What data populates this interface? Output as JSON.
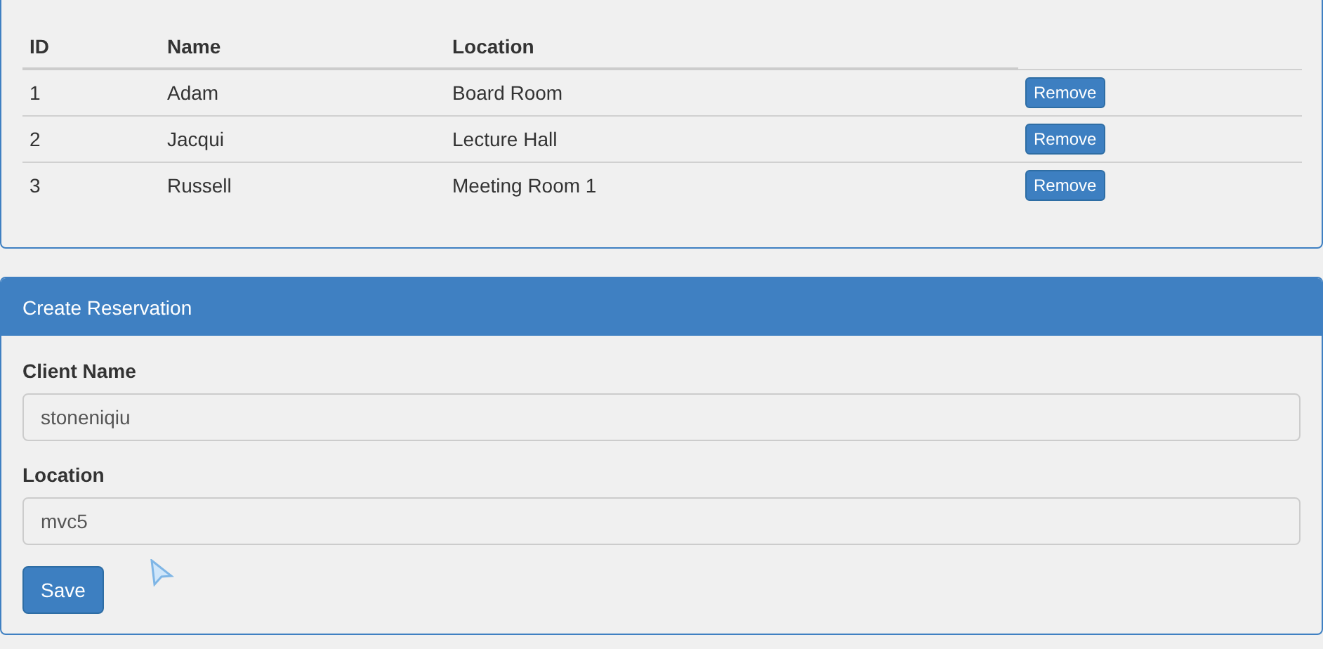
{
  "table": {
    "columns": [
      {
        "label": "ID"
      },
      {
        "label": "Name"
      },
      {
        "label": "Location"
      }
    ],
    "rows": [
      {
        "id": "1",
        "name": "Adam",
        "location": "Board Room",
        "action": "Remove"
      },
      {
        "id": "2",
        "name": "Jacqui",
        "location": "Lecture Hall",
        "action": "Remove"
      },
      {
        "id": "3",
        "name": "Russell",
        "location": "Meeting Room 1",
        "action": "Remove"
      }
    ]
  },
  "form": {
    "title": "Create Reservation",
    "fields": [
      {
        "label": "Client Name",
        "value": "stoneniqiu"
      },
      {
        "label": "Location",
        "value": "mvc5"
      }
    ],
    "submit": "Save"
  }
}
